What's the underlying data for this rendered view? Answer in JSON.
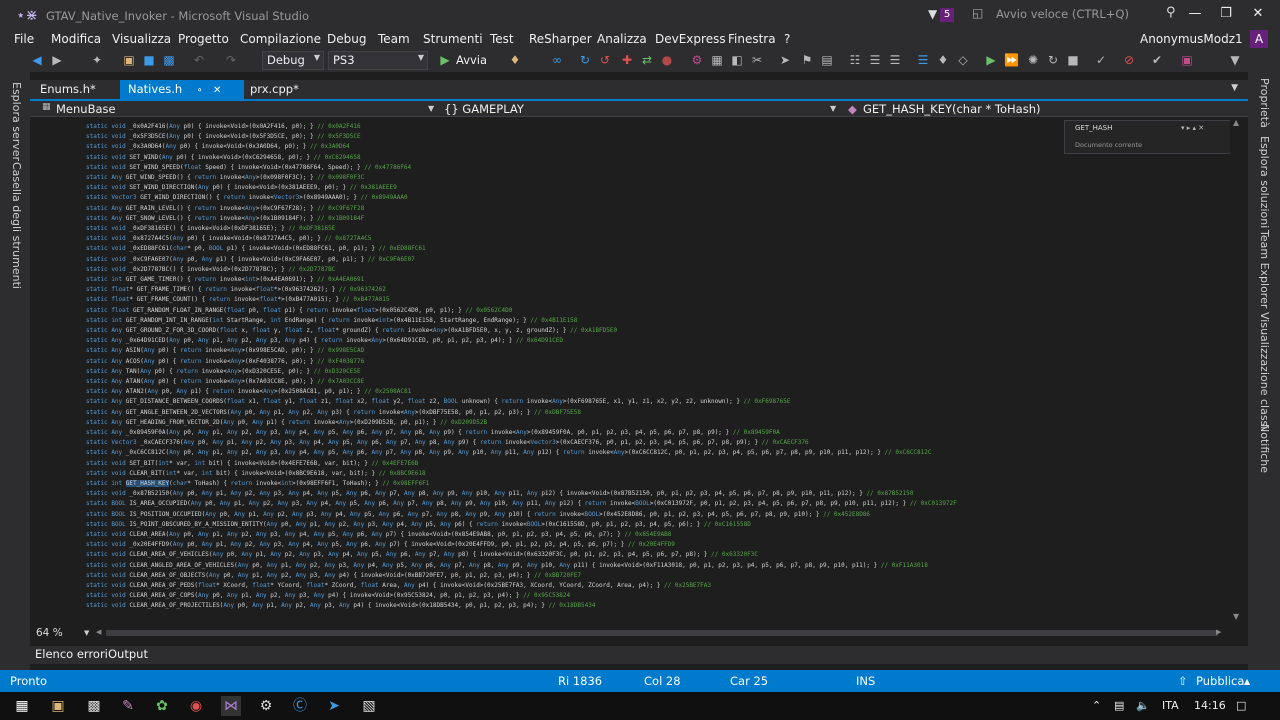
{
  "window": {
    "title": "GTAV_Native_Invoker - Microsoft Visual Studio",
    "notifications": "5",
    "quick_launch_placeholder": "Avvio veloce (CTRL+Q)"
  },
  "menu": [
    "File",
    "Modifica",
    "Visualizza",
    "Progetto",
    "Compilazione",
    "Debug",
    "Team",
    "Strumenti",
    "Test",
    "ReSharper",
    "Analizza",
    "DevExpress",
    "Finestra",
    "?"
  ],
  "user": {
    "name": "AnonymusModz1",
    "initial": "A"
  },
  "toolbar": {
    "config": "Debug",
    "platform": "PS3",
    "run_label": "Avvia"
  },
  "left_dock": {
    "tabs": [
      "Esplora server",
      "Casella degli strumenti"
    ]
  },
  "right_dock": {
    "tabs": [
      "Proprietà",
      "Esplora soluzioni",
      "Team Explorer",
      "Visualizzazione classi",
      "Notifiche"
    ]
  },
  "doc_tabs": [
    "Enums.h*",
    "Natives.h",
    "prx.cpp*"
  ],
  "navbar": {
    "project": "MenuBase",
    "scope": "{} GAMEPLAY",
    "member": "GET_HASH_KEY(char * ToHash)"
  },
  "find_widget": {
    "text": "GET_HASH",
    "scope": "Documento corrente"
  },
  "code_lines": [
    "static void _0x0A2F416(Any p0) { invoke<Void>(0x0A2F416, p0); } // 0x0A2F416",
    "static void _0x5F3D5CE(Any p0) { invoke<Void>(0x5F3D5CE, p0); } // 0x5F3D5CE",
    "static void _0x3A0D64(Any p0) { invoke<Void>(0x3A0D64, p0); } // 0x3A0D64",
    "static void SET_WIND(Any p0) { invoke<Void>(0xC6294658, p0); } // 0xC6294658",
    "static void SET_WIND_SPEED(float Speed) { invoke<Void>(0x47786F64, Speed); } // 0x47786F64",
    "static Any GET_WIND_SPEED() { return invoke<Any>(0x098F0F3C); } // 0x098F0F3C",
    "static void SET_WIND_DIRECTION(Any p0) { invoke<Void>(0x381AEEE9, p0); } // 0x381AEEE9",
    "static Vector3 GET_WIND_DIRECTION() { return invoke<Vector3>(0x8949AAA0); } // 0x8949AAA0",
    "static Any GET_RAIN_LEVEL() { return invoke<Any>(0xC9F67F28); } // 0xC9F67F28",
    "static Any GET_SNOW_LEVEL() { return invoke<Any>(0x1B09184F); } // 0x1B09184F",
    "static void _0xDF38165E() { invoke<Void>(0xDF38165E); } // 0xDF38165E",
    "static void _0x8727A4C5(Any p0) { invoke<Void>(0x8727A4C5, p0); } // 0x8727A4C5",
    "static void _0xED88FC61(char* p0, BOOL p1) { invoke<Void>(0xED88FC61, p0, p1); } // 0xED88FC61",
    "static void _0xC9FA6E07(Any p0, Any p1) { invoke<Void>(0xC9FA6E07, p0, p1); } // 0xC9FA6E07",
    "static void _0x2D7787BC() { invoke<Void>(0x2D7787BC); } // 0x2D7787BC",
    "static int GET_GAME_TIMER() { return invoke<int>(0xA4EA0691); } // 0xA4EA0691",
    "static float* GET_FRAME_TIME() { return invoke<float*>(0x96374262); } // 0x96374262",
    "static float* GET_FRAME_COUNT() { return invoke<float*>(0xB477A015); } // 0xB477A015",
    "static float GET_RANDOM_FLOAT_IN_RANGE(float p0, float p1) { return invoke<float>(0x0562C4D0, p0, p1); } // 0x0562C4D0",
    "static int GET_RANDOM_INT_IN_RANGE(int StartRange, int EndRange) { return invoke<int>(0x4B11E158, StartRange, EndRange); } // 0x4B11E158",
    "static Any GET_GROUND_Z_FOR_3D_COORD(float x, float y, float z, float* groundZ) { return invoke<Any>(0xA1BFD5E0, x, y, z, groundZ); } // 0xA1BFD5E0",
    "static Any _0x64D91CED(Any p0, Any p1, Any p2, Any p3, Any p4) { return invoke<Any>(0x64D91CED, p0, p1, p2, p3, p4); } // 0x64D91CED",
    "static Any ASIN(Any p0) { return invoke<Any>(0x998E5CAD, p0); } // 0x998E5CAD",
    "static Any ACOS(Any p0) { return invoke<Any>(0xF4038776, p0); } // 0xF4038776",
    "static Any TAN(Any p0) { return invoke<Any>(0xD320CE5E, p0); } // 0xD320CE5E",
    "static Any ATAN(Any p0) { return invoke<Any>(0x7A03CC8E, p0); } // 0x7A03CC8E",
    "static Any ATAN2(Any p0, Any p1) { return invoke<Any>(0x2508AC81, p0, p1); } // 0x2508AC81",
    "static Any GET_DISTANCE_BETWEEN_COORDS(float x1, float y1, float z1, float x2, float y2, float z2, BOOL unknown) { return invoke<Any>(0xF698765E, x1, y1, z1, x2, y2, z2, unknown); } // 0xF698765E",
    "static Any GET_ANGLE_BETWEEN_2D_VECTORS(Any p0, Any p1, Any p2, Any p3) { return invoke<Any>(0xDBF75E58, p0, p1, p2, p3); } // 0xDBF75E58",
    "static Any GET_HEADING_FROM_VECTOR_2D(Any p0, Any p1) { return invoke<Any>(0xD209D52B, p0, p1); } // 0xD209D52B",
    "static Any _0x89459F0A(Any p0, Any p1, Any p2, Any p3, Any p4, Any p5, Any p6, Any p7, Any p8, Any p9) { return invoke<Any>(0x89459F0A, p0, p1, p2, p3, p4, p5, p6, p7, p8, p9); } // 0x89459F0A",
    "static Vector3 _0xCAECF376(Any p0, Any p1, Any p2, Any p3, Any p4, Any p5, Any p6, Any p7, Any p8, Any p9) { return invoke<Vector3>(0xCAECF376, p0, p1, p2, p3, p4, p5, p6, p7, p8, p9); } // 0xCAECF376",
    "static Any _0xC6CC812C(Any p0, Any p1, Any p2, Any p3, Any p4, Any p5, Any p6, Any p7, Any p8, Any p9, Any p10, Any p11, Any p12) { return invoke<Any>(0xC6CC812C, p0, p1, p2, p3, p4, p5, p6, p7, p8, p9, p10, p11, p12); } // 0xC6CC812C",
    "static void SET_BIT(int* var, int bit) { invoke<Void>(0x4EFE7E6B, var, bit); } // 0x4EFE7E6B",
    "static void CLEAR_BIT(int* var, int bit) { invoke<Void>(0x8BC9E618, var, bit); } // 0x8BC9E618",
    "static int GET_HASH_KEY(char* ToHash) { return invoke<int>(0x98EFF6F1, ToHash); } // 0x98EFF6F1",
    "static void _0x87B52150(Any p0, Any p1, Any p2, Any p3, Any p4, Any p5, Any p6, Any p7, Any p8, Any p9, Any p10, Any p11, Any p12) { invoke<Void>(0x87B52150, p0, p1, p2, p3, p4, p5, p6, p7, p8, p9, p10, p11, p12); } // 0x87B52150",
    "static BOOL IS_AREA_OCCUPIED(Any p0, Any p1, Any p2, Any p3, Any p4, Any p5, Any p6, Any p7, Any p8, Any p9, Any p10, Any p11, Any p12) { return invoke<BOOL>(0xC013972F, p0, p1, p2, p3, p4, p5, p6, p7, p8, p9, p10, p11, p12); } // 0xC013972F",
    "static BOOL IS_POSITION_OCCUPIED(Any p0, Any p1, Any p2, Any p3, Any p4, Any p5, Any p6, Any p7, Any p8, Any p9, Any p10) { return invoke<BOOL>(0x452E8D86, p0, p1, p2, p3, p4, p5, p6, p7, p8, p9, p10); } // 0x452E8D86",
    "static BOOL IS_POINT_OBSCURED_BY_A_MISSION_ENTITY(Any p0, Any p1, Any p2, Any p3, Any p4, Any p5, Any p6) { return invoke<BOOL>(0xC161558D, p0, p1, p2, p3, p4, p5, p6); } // 0xC161558D",
    "static void CLEAR_AREA(Any p0, Any p1, Any p2, Any p3, Any p4, Any p5, Any p6, Any p7) { invoke<Void>(0x854E9AB8, p0, p1, p2, p3, p4, p5, p6, p7); } // 0x854E9AB8",
    "static void _0x20E4FFD9(Any p0, Any p1, Any p2, Any p3, Any p4, Any p5, Any p6, Any p7) { invoke<Void>(0x20E4FFD9, p0, p1, p2, p3, p4, p5, p6, p7); } // 0x20E4FFD9",
    "static void CLEAR_AREA_OF_VEHICLES(Any p0, Any p1, Any p2, Any p3, Any p4, Any p5, Any p6, Any p7, Any p8) { invoke<Void>(0x63320F3C, p0, p1, p2, p3, p4, p5, p6, p7, p8); } // 0x63320F3C",
    "static void CLEAR_ANGLED_AREA_OF_VEHICLES(Any p0, Any p1, Any p2, Any p3, Any p4, Any p5, Any p6, Any p7, Any p8, Any p9, Any p10, Any p11) { invoke<Void>(0xF11A3018, p0, p1, p2, p3, p4, p5, p6, p7, p8, p9, p10, p11); } // 0xF11A3018",
    "static void CLEAR_AREA_OF_OBJECTS(Any p0, Any p1, Any p2, Any p3, Any p4) { invoke<Void>(0xBB720FE7, p0, p1, p2, p3, p4); } // 0xBB720FE7",
    "static void CLEAR_AREA_OF_PEDS(float* XCoord, float* YCoord, float* ZCoord, float Area, Any p4) { invoke<Void>(0x25BE7FA3, XCoord, YCoord, ZCoord, Area, p4); } // 0x25BE7FA3",
    "static void CLEAR_AREA_OF_COPS(Any p0, Any p1, Any p2, Any p3, Any p4) { invoke<Void>(0x95C53824, p0, p1, p2, p3, p4); } // 0x95C53824",
    "static void CLEAR_AREA_OF_PROJECTILES(Any p0, Any p1, Any p2, Any p3, Any p4) { invoke<Void>(0x18DB5434, p0, p1, p2, p3, p4); } // 0x18DB5434"
  ],
  "highlight_line_index": 35,
  "zoom": "64 %",
  "output_tabs": [
    "Elenco errori",
    "Output"
  ],
  "status": {
    "state": "Pronto",
    "line": "Ri 1836",
    "col": "Col 28",
    "char": "Car 25",
    "mode": "INS",
    "publish": "Pubblica"
  },
  "taskbar": {
    "lang": "ITA",
    "time": "14:16"
  },
  "colors": {
    "accent": "#007acc",
    "vs_purple": "#68217a",
    "comment": "#57a64a",
    "keyword": "#569cd6"
  }
}
